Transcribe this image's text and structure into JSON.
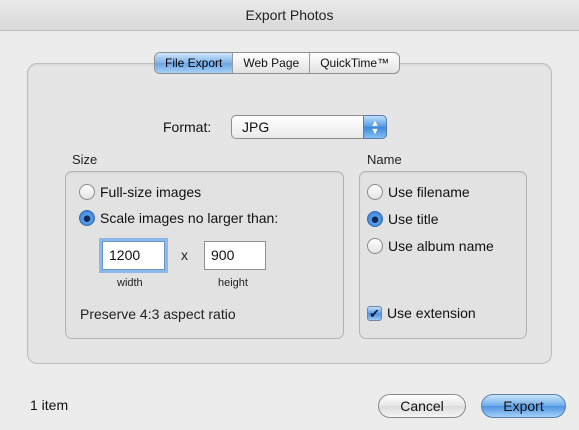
{
  "window": {
    "title": "Export Photos"
  },
  "tabs": [
    {
      "label": "File Export",
      "active": true
    },
    {
      "label": "Web Page",
      "active": false
    },
    {
      "label": "QuickTime™",
      "active": false
    }
  ],
  "format": {
    "label": "Format:",
    "value": "JPG"
  },
  "size": {
    "title": "Size",
    "options": [
      {
        "label": "Full-size images",
        "selected": false
      },
      {
        "label": "Scale images no larger than:",
        "selected": true
      }
    ],
    "width": {
      "value": "1200",
      "caption": "width"
    },
    "times": "x",
    "height": {
      "value": "900",
      "caption": "height"
    },
    "aspect_note": "Preserve 4:3 aspect ratio"
  },
  "name": {
    "title": "Name",
    "options": [
      {
        "label": "Use filename",
        "selected": false
      },
      {
        "label": "Use title",
        "selected": true
      },
      {
        "label": "Use album name",
        "selected": false
      }
    ],
    "extension": {
      "label": "Use extension",
      "checked": true
    }
  },
  "footer": {
    "count": "1 item",
    "cancel": "Cancel",
    "export": "Export"
  },
  "colors": {
    "accent": "#4d93e2"
  },
  "icons": {
    "checkbox_mark": "✔",
    "popup_arrows": "▲▼"
  }
}
